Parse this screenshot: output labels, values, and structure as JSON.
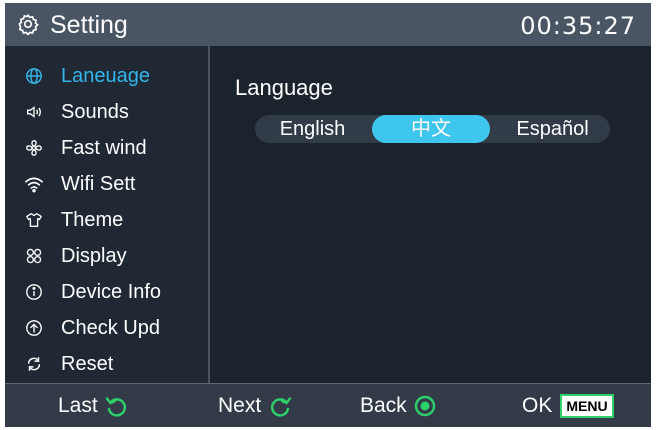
{
  "header": {
    "title": "Setting",
    "time": "00:35:27"
  },
  "sidebar": {
    "items": [
      {
        "label": "Laneuage",
        "icon": "globe-icon",
        "active": true
      },
      {
        "label": "Sounds",
        "icon": "speaker-icon"
      },
      {
        "label": "Fast wind",
        "icon": "fan-icon"
      },
      {
        "label": "Wifi Sett",
        "icon": "wifi-icon"
      },
      {
        "label": "Theme",
        "icon": "shirt-icon"
      },
      {
        "label": "Display",
        "icon": "grid-icon"
      },
      {
        "label": "Device Info",
        "icon": "info-icon"
      },
      {
        "label": "Check Upd",
        "icon": "upload-icon"
      },
      {
        "label": "Reset",
        "icon": "reset-icon"
      }
    ]
  },
  "content": {
    "section_title": "Language",
    "options": [
      "English",
      "中文",
      "Español"
    ],
    "selected": "中文"
  },
  "footer": {
    "last_label": "Last",
    "next_label": "Next",
    "back_label": "Back",
    "ok_label": "OK",
    "menu_key": "MENU"
  },
  "colors": {
    "accent": "#33b6ea",
    "selected_bg": "#3fc6ef",
    "footer_icon": "#2dd16b"
  }
}
